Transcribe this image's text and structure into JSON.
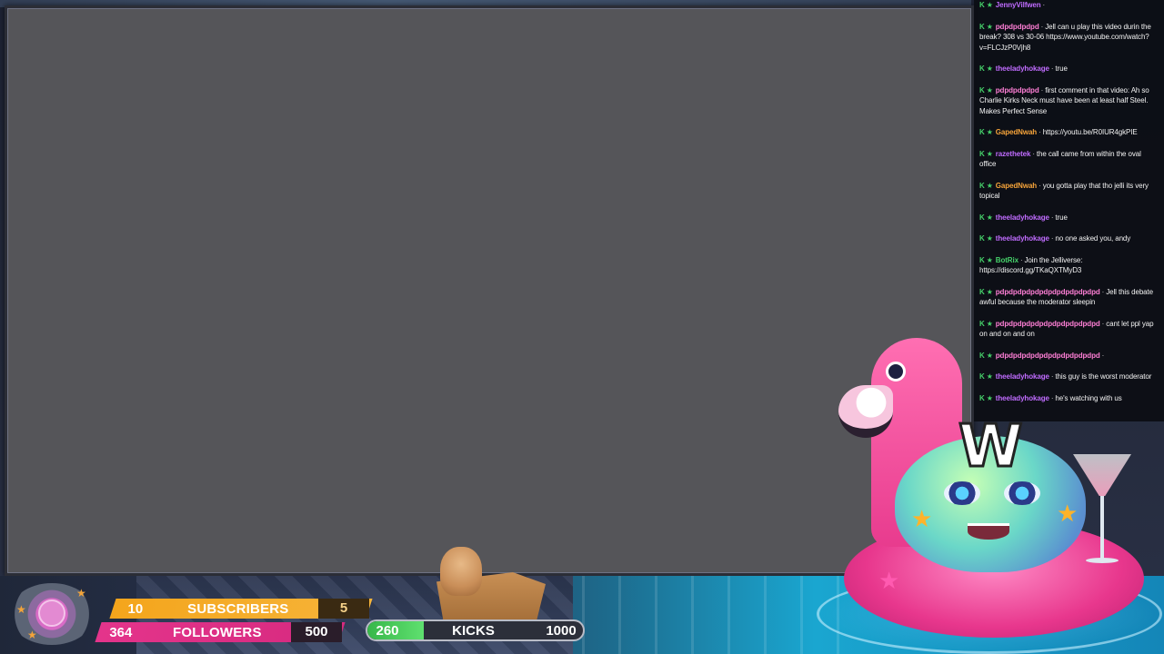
{
  "chat": {
    "messages": [
      {
        "user": "JennyVilfwen",
        "user_color": "#c06cff",
        "text": ""
      },
      {
        "user": "pdpdpdpdpd",
        "user_color": "#ff7fd6",
        "text": "Jell can u play this video durin the break? 308 vs 30-06 https://www.youtube.com/watch?v=FLCJzP0Vjh8"
      },
      {
        "user": "theeladyhokage",
        "user_color": "#c06cff",
        "text": "true"
      },
      {
        "user": "pdpdpdpdpd",
        "user_color": "#ff7fd6",
        "text": "first comment in that video: Ah so Charlie Kirks Neck must have been at least half Steel. Makes Perfect Sense"
      },
      {
        "user": "GapedNwah",
        "user_color": "#f6a43a",
        "text": "https://youtu.be/R0IUR4gkPIE"
      },
      {
        "user": "razethetek",
        "user_color": "#c06cff",
        "text": "the call came from within the oval office"
      },
      {
        "user": "GapedNwah",
        "user_color": "#f6a43a",
        "text": "you gotta play that tho jelli its very topical"
      },
      {
        "user": "theeladyhokage",
        "user_color": "#c06cff",
        "text": "true"
      },
      {
        "user": "theeladyhokage",
        "user_color": "#c06cff",
        "text": "no one asked you, andy"
      },
      {
        "user": "BotRix",
        "user_color": "#46d16a",
        "text": "Join the Jelliverse: https://discord.gg/TKaQXTMyD3"
      },
      {
        "user": "pdpdpdpdpdpdpdpdpdpdpdpd",
        "user_color": "#ff7fd6",
        "text": "Jell this debate awful because the moderator sleepin"
      },
      {
        "user": "pdpdpdpdpdpdpdpdpdpdpdpd",
        "user_color": "#ff7fd6",
        "text": "cant let ppl yap on and on and on"
      },
      {
        "user": "pdpdpdpdpdpdpdpdpdpdpdpd",
        "user_color": "#ff7fd6",
        "text": ""
      },
      {
        "user": "theeladyhokage",
        "user_color": "#c06cff",
        "text": "this guy is the worst moderator"
      },
      {
        "user": "theeladyhokage",
        "user_color": "#c06cff",
        "text": "he's watching with us"
      }
    ]
  },
  "goals": {
    "subscribers": {
      "current": "10",
      "label": "SUBSCRIBERS",
      "target": "5",
      "color": "#f4a51c"
    },
    "followers": {
      "current": "364",
      "label": "FOLLOWERS",
      "target": "500",
      "color": "#e4348b"
    },
    "kicks": {
      "current": "260",
      "label": "KICKS",
      "target": "1000",
      "progress": 0.26,
      "color": "#37b74a"
    }
  },
  "mascot": {
    "label": "W"
  },
  "icons": {
    "badge": "check-badge-icon",
    "logo": "channel-logo-icon",
    "mascot": "flamingo-float-mascot",
    "cat": "cat-in-box-icon"
  }
}
